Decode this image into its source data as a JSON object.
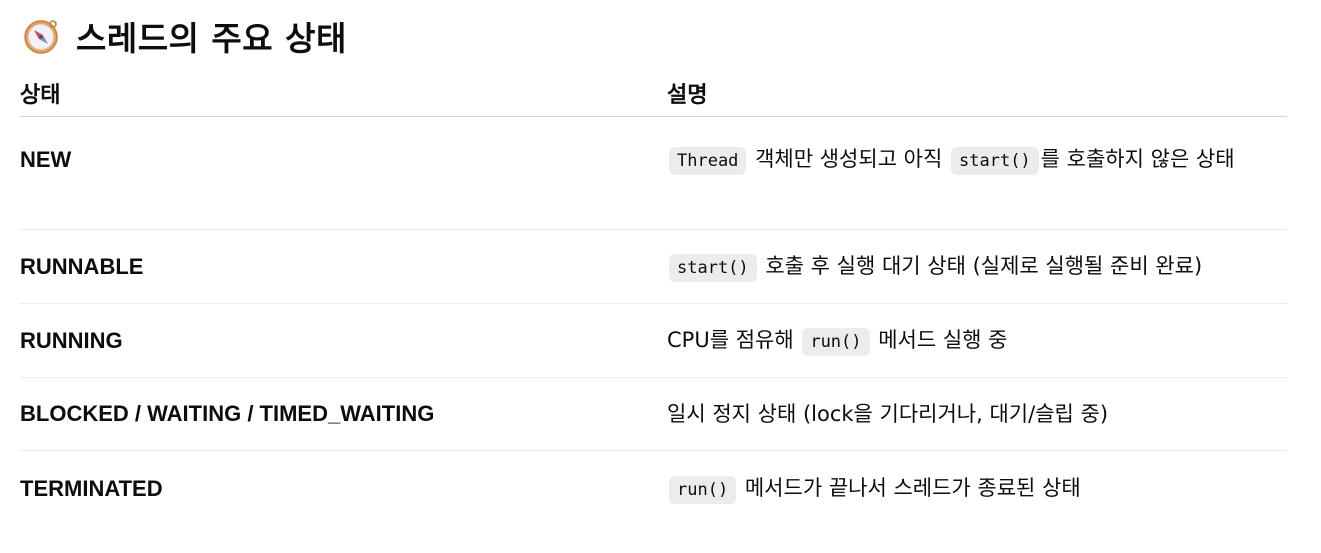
{
  "heading": {
    "icon": "compass-icon",
    "title": "스레드의 주요 상태"
  },
  "table": {
    "headers": {
      "state": "상태",
      "description": "설명"
    },
    "rows": [
      {
        "state": "NEW",
        "desc": {
          "code1": "Thread",
          "text1": " 객체만 생성되고 아직 ",
          "code2": "start()",
          "text2": "를 호출하지 않은 상태"
        }
      },
      {
        "state": "RUNNABLE",
        "desc": {
          "code1": "start()",
          "text1": " 호출 후 실행 대기 상태 (실제로 실행될 준비 완료)"
        }
      },
      {
        "state": "RUNNING",
        "desc": {
          "text1": "CPU를 점유해 ",
          "code1": "run()",
          "text2": " 메서드 실행 중"
        }
      },
      {
        "state": "BLOCKED / WAITING / TIMED_WAITING",
        "desc": {
          "text1": "일시 정지 상태 (lock을 기다리거나, 대기/슬립 중)"
        }
      },
      {
        "state": "TERMINATED",
        "desc": {
          "code1": "run()",
          "text1": " 메서드가 끝나서 스레드가 종료된 상태"
        }
      }
    ]
  }
}
